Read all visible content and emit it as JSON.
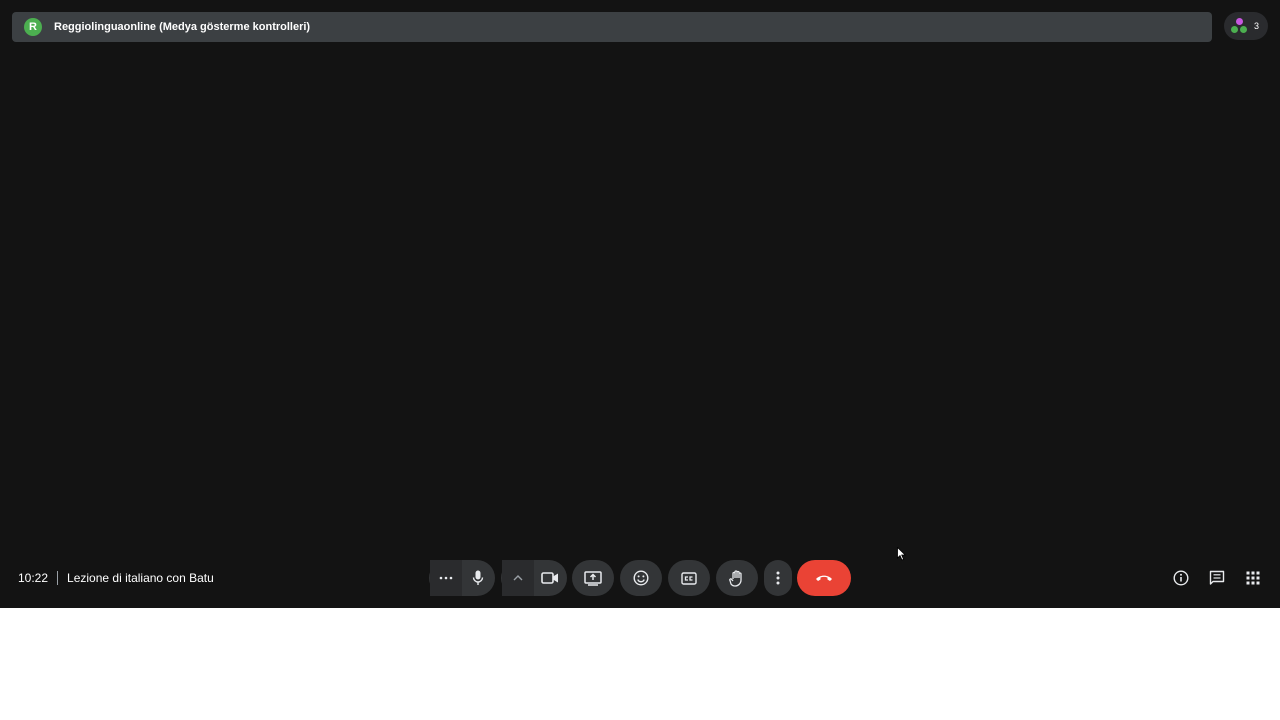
{
  "top_bar": {
    "avatar_initial": "R",
    "presenter_label": "Reggiolinguaonline (Medya gösterme kontrolleri)"
  },
  "participants": {
    "count": "3"
  },
  "meeting": {
    "time": "10:22",
    "title": "Lezione di italiano con Batu"
  },
  "controls": [
    {
      "name": "more-reactions-button",
      "icon": "ellipsis-icon"
    },
    {
      "name": "microphone-button",
      "icon": "mic-icon"
    },
    {
      "name": "camera-options-button",
      "icon": "chevron-up-icon"
    },
    {
      "name": "camera-button",
      "icon": "videocam-icon"
    },
    {
      "name": "present-screen-button",
      "icon": "present-to-all-icon"
    },
    {
      "name": "emoji-button",
      "icon": "emoji-icon"
    },
    {
      "name": "captions-button",
      "icon": "closed-caption-icon"
    },
    {
      "name": "raise-hand-button",
      "icon": "hand-icon"
    },
    {
      "name": "more-options-button",
      "icon": "vertical-dots-icon"
    },
    {
      "name": "leave-call-button",
      "icon": "call-end-icon"
    }
  ],
  "side_actions": [
    {
      "name": "meeting-details-button",
      "icon": "info-icon"
    },
    {
      "name": "chat-button",
      "icon": "chat-icon"
    },
    {
      "name": "activities-button",
      "icon": "apps-grid-icon"
    }
  ],
  "colors": {
    "stage_bg": "#131313",
    "control_bg": "#333537",
    "end_call": "#ea4335",
    "avatar": "#4caf50",
    "banner_bg": "#3c4043"
  }
}
